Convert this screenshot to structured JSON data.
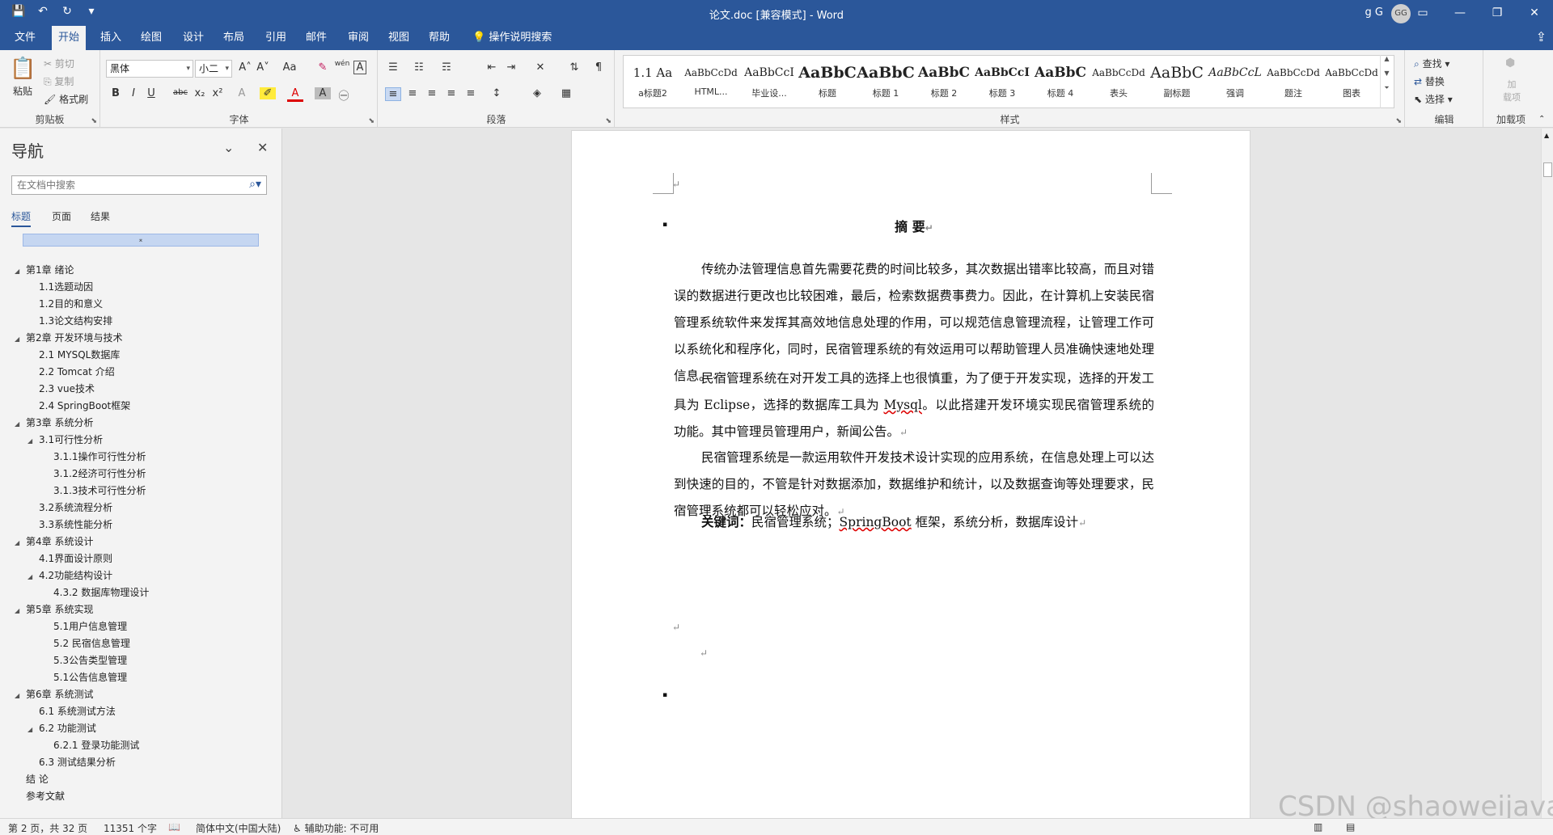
{
  "titlebar": {
    "title": "论文.doc [兼容模式] - Word",
    "user": "g G",
    "avatar": "GG",
    "quick_access": {
      "save": "💾",
      "undo": "↶",
      "redo": "↻",
      "customize": "▾"
    },
    "window_icons": {
      "ribbon_display": "▭",
      "minimize": "—",
      "restore": "❐",
      "close": "✕"
    }
  },
  "tabs": [
    "文件",
    "开始",
    "插入",
    "绘图",
    "设计",
    "布局",
    "引用",
    "邮件",
    "审阅",
    "视图",
    "帮助"
  ],
  "active_tab": "开始",
  "help_search": "操作说明搜索",
  "ribbon": {
    "clipboard": {
      "label": "剪贴板",
      "paste": "粘贴",
      "cut": "剪切",
      "copy": "复制",
      "format_painter": "格式刷"
    },
    "font": {
      "label": "字体",
      "font_name": "黑体",
      "font_size": "小二",
      "grow": "A˄",
      "shrink": "A˅",
      "case": "Aa",
      "clear": "✎",
      "phonetic": "wén",
      "border": "A",
      "bold": "B",
      "italic": "I",
      "underline": "U",
      "strike": "abc",
      "sub": "x₂",
      "sup": "x²",
      "effects": "A",
      "highlight": "✐",
      "color": "A",
      "shading": "A",
      "enclose": "㊀"
    },
    "paragraph": {
      "label": "段落",
      "bullets": "☰",
      "numbering": "☷",
      "multilevel": "☶",
      "decrease": "⇤",
      "increase": "⇥",
      "asian": "✕",
      "sort": "⇅",
      "marks": "¶",
      "align_left": "≡",
      "center": "≡",
      "align_right": "≡",
      "justify": "≡",
      "distribute": "≡",
      "spacing": "↕",
      "shade": "◈",
      "borders": "▦"
    },
    "styles": {
      "label": "样式",
      "items": [
        {
          "preview": "1.1  Aa",
          "name": "a标题2"
        },
        {
          "preview": "AaBbCcDd",
          "name": "HTML..."
        },
        {
          "preview": "AaBbCcI",
          "name": "毕业设..."
        },
        {
          "preview": "AaBbC",
          "name": "标题"
        },
        {
          "preview": "AaBbC",
          "name": "标题 1"
        },
        {
          "preview": "AaBbC",
          "name": "标题 2"
        },
        {
          "preview": "AaBbCcI",
          "name": "标题 3"
        },
        {
          "preview": "AaBbC",
          "name": "标题 4"
        },
        {
          "preview": "AaBbCcDd",
          "name": "表头"
        },
        {
          "preview": "AaBbC",
          "name": "副标题"
        },
        {
          "preview": "AaBbCcL",
          "name": "强调"
        },
        {
          "preview": "AaBbCcDd",
          "name": "题注"
        },
        {
          "preview": "AaBbCcDd",
          "name": "图表"
        }
      ]
    },
    "editing": {
      "label": "编辑",
      "find": "查找",
      "replace": "替换",
      "select": "选择"
    },
    "addins": {
      "label": "加载项",
      "addin": "加\n载项"
    }
  },
  "nav": {
    "title": "导航",
    "search_placeholder": "在文档中搜索",
    "tabs": [
      "标题",
      "页面",
      "结果"
    ],
    "collapse_glyph": "⌅",
    "outline": [
      {
        "text": "第1章 绪论",
        "level": 1,
        "tri": "◢"
      },
      {
        "text": "1.1选题动因",
        "level": 2,
        "tri": ""
      },
      {
        "text": "1.2目的和意义",
        "level": 2,
        "tri": ""
      },
      {
        "text": "1.3论文结构安排",
        "level": 2,
        "tri": ""
      },
      {
        "text": "第2章 开发环境与技术",
        "level": 1,
        "tri": "◢"
      },
      {
        "text": "2.1 MYSQL数据库",
        "level": 2,
        "tri": ""
      },
      {
        "text": "2.2 Tomcat 介绍",
        "level": 2,
        "tri": ""
      },
      {
        "text": "2.3 vue技术",
        "level": 2,
        "tri": ""
      },
      {
        "text": "2.4 SpringBoot框架",
        "level": 2,
        "tri": ""
      },
      {
        "text": "第3章 系统分析",
        "level": 1,
        "tri": "◢"
      },
      {
        "text": "3.1可行性分析",
        "level": 2,
        "tri": "◢"
      },
      {
        "text": "3.1.1操作可行性分析",
        "level": 3,
        "tri": ""
      },
      {
        "text": "3.1.2经济可行性分析",
        "level": 3,
        "tri": ""
      },
      {
        "text": "3.1.3技术可行性分析",
        "level": 3,
        "tri": ""
      },
      {
        "text": "3.2系统流程分析",
        "level": 2,
        "tri": ""
      },
      {
        "text": "3.3系统性能分析",
        "level": 2,
        "tri": ""
      },
      {
        "text": "第4章 系统设计",
        "level": 1,
        "tri": "◢"
      },
      {
        "text": "4.1界面设计原则",
        "level": 2,
        "tri": ""
      },
      {
        "text": "4.2功能结构设计",
        "level": 2,
        "tri": "◢"
      },
      {
        "text": "4.3.2 数据库物理设计",
        "level": 3,
        "tri": ""
      },
      {
        "text": "第5章 系统实现",
        "level": 1,
        "tri": "◢"
      },
      {
        "text": "5.1用户信息管理",
        "level": 3,
        "tri": ""
      },
      {
        "text": "5.2 民宿信息管理",
        "level": 3,
        "tri": ""
      },
      {
        "text": "5.3公告类型管理",
        "level": 3,
        "tri": ""
      },
      {
        "text": "5.1公告信息管理",
        "level": 3,
        "tri": ""
      },
      {
        "text": "第6章 系统测试",
        "level": 1,
        "tri": "◢"
      },
      {
        "text": "6.1 系统测试方法",
        "level": 2,
        "tri": ""
      },
      {
        "text": "6.2 功能测试",
        "level": 2,
        "tri": "◢"
      },
      {
        "text": "6.2.1 登录功能测试",
        "level": 3,
        "tri": ""
      },
      {
        "text": "6.3 测试结果分析",
        "level": 2,
        "tri": ""
      },
      {
        "text": "结  论",
        "level": 1,
        "tri": ""
      },
      {
        "text": "参考文献",
        "level": 1,
        "tri": ""
      }
    ]
  },
  "document": {
    "heading": "摘  要",
    "para_mark": "↵",
    "bullet": "▪",
    "p1": "传统办法管理信息首先需要花费的时间比较多，其次数据出错率比较高，而且对错误的数据进行更改也比较困难，最后，检索数据费事费力。因此，在计算机上安装民宿管理系统软件来发挥其高效地信息处理的作用，可以规范信息管理流程，让管理工作可以系统化和程序化，同时，民宿管理系统的有效运用可以帮助管理人员准确快速地处理信息。",
    "p2a": "民宿管理系统在对开发工具的选择上也很慎重，为了便于开发实现，选择的开发工具为 Eclipse，选择的数据库工具为 ",
    "p2_mysql": "Mysql",
    "p2b": "。以此搭建开发环境实现民宿管理系统的功能。其中管理员管理用户，新闻公告。",
    "p3": "民宿管理系统是一款运用软件开发技术设计实现的应用系统，在信息处理上可以达到快速的目的，不管是针对数据添加，数据维护和统计，以及数据查询等处理要求，民宿管理系统都可以轻松应对。",
    "kw_label": "关键词：",
    "kw_a": "民宿管理系统；",
    "kw_springboot": "SpringBoot",
    "kw_b": " 框架，系统分析，数据库设计"
  },
  "status": {
    "page": "第 2 页，共 32 页",
    "words": "11351 个字",
    "proof_icon": "📖",
    "language": "简体中文(中国大陆)",
    "accessibility": "辅助功能: 不可用"
  },
  "watermark": "CSDN @shaoweijava"
}
